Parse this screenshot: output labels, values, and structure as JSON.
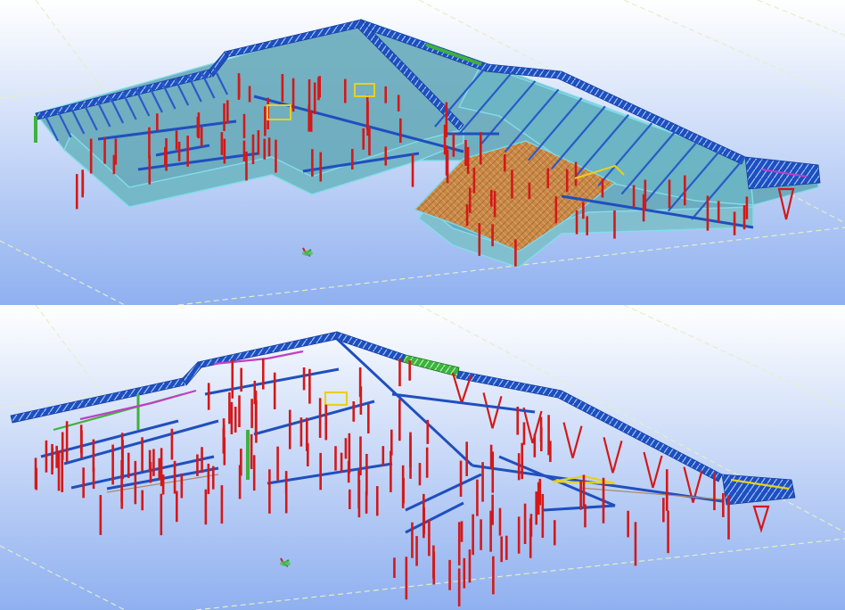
{
  "viewports": [
    {
      "name": "structural-model-with-cladding",
      "cladding": true
    },
    {
      "name": "structural-frame-only",
      "cladding": false
    }
  ],
  "colors": {
    "sky_top": "#ffffff",
    "sky_bottom": "#90b0f0",
    "grid_line": "#e8f0c8",
    "primary_beam": "#1f4fbf",
    "truss": "#2c63c8",
    "column": "#d42020",
    "cladding_fill": "#5fa8b8",
    "cladding_edge": "#7fd8e6",
    "green_member": "#3cb43c",
    "yellow_member": "#e8d020",
    "magenta_member": "#c040c0",
    "orange_deck": "#d8843c"
  },
  "icons": [
    "coordinate-axis-icon"
  ]
}
